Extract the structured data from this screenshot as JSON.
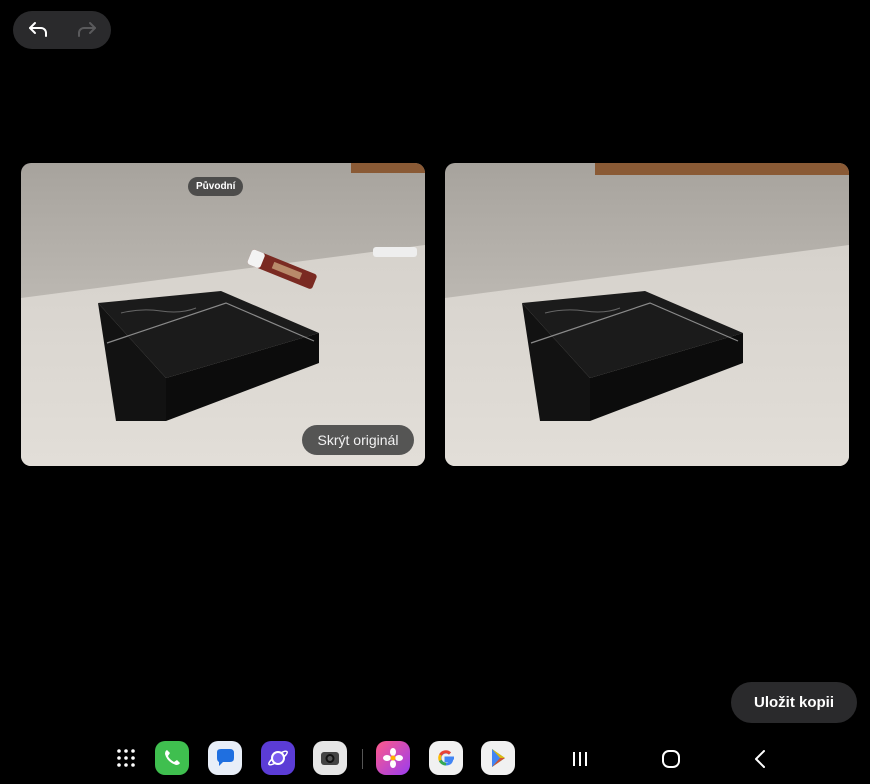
{
  "toolbar": {
    "undo_icon": "undo-arrow-icon",
    "redo_icon": "redo-arrow-icon"
  },
  "compare": {
    "original_label": "Původní",
    "hide_original_label": "Skrýt originál"
  },
  "actions": {
    "save_copy_label": "Uložit kopii"
  },
  "taskbar": {
    "apps": [
      "app-drawer",
      "phone",
      "messages",
      "internet",
      "camera",
      "gallery",
      "google",
      "play-store"
    ],
    "nav": [
      "recents",
      "home",
      "back"
    ]
  }
}
